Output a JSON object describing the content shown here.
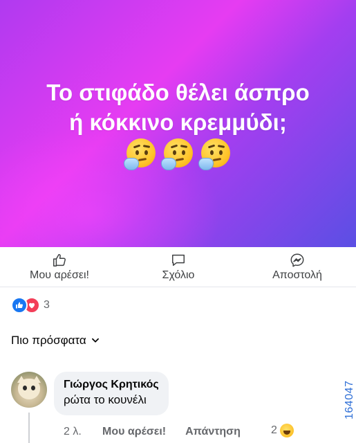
{
  "post": {
    "line1": "Το στιφάδο θέλει άσπρο",
    "line2": "ή κόκκινο κρεμμύδι;",
    "emoji_icons": [
      "thinking-face-icon",
      "thinking-face-icon",
      "thinking-face-icon"
    ],
    "colors": {
      "gradient_start": "#e63cf2",
      "gradient_end": "#5b4fe4"
    }
  },
  "actions": {
    "like_label": "Μου αρέσει!",
    "comment_label": "Σχόλιο",
    "send_label": "Αποστολή"
  },
  "reactions": {
    "count": "3",
    "types": [
      "like",
      "love"
    ]
  },
  "sort": {
    "label": "Πιο πρόσφατα"
  },
  "comment": {
    "author": "Γιώργος Κρητικός",
    "text": "ρώτα το κουνέλι",
    "time": "2 λ.",
    "like_label": "Μου αρέσει!",
    "reply_label": "Απάντηση",
    "reaction_count": "2"
  },
  "watermark": "164047"
}
